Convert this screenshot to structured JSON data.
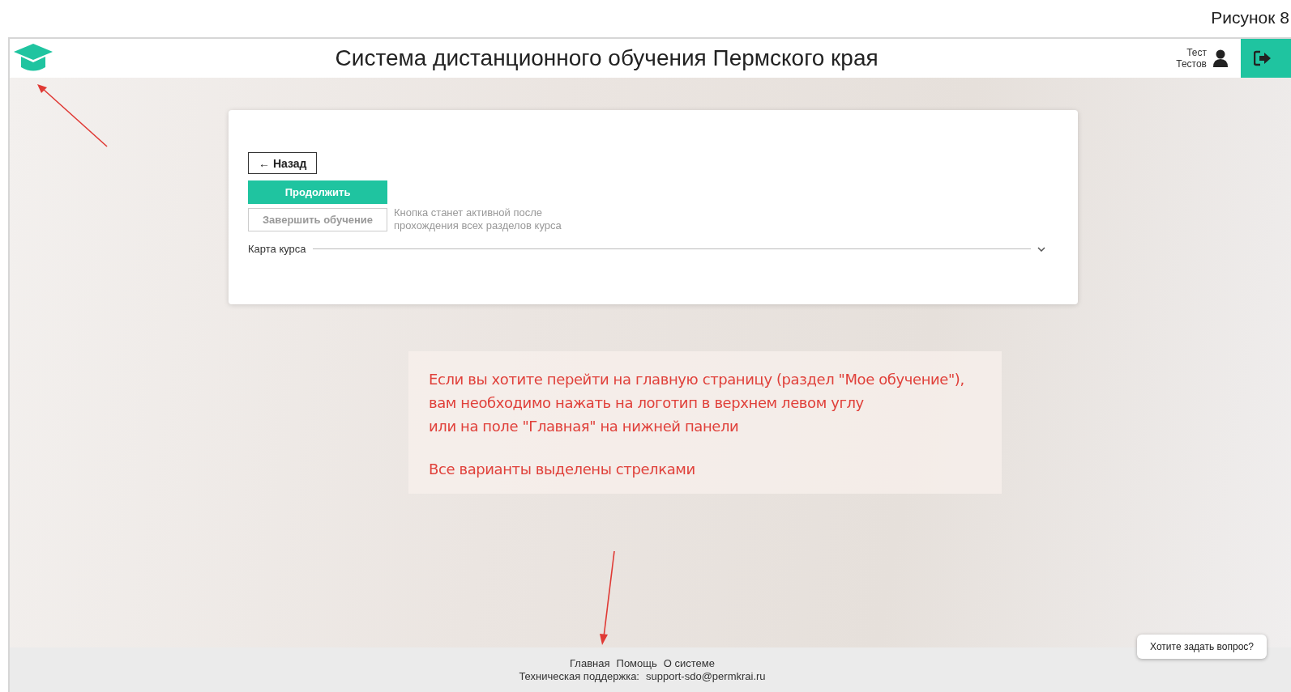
{
  "caption": "Рисунок 8",
  "header": {
    "title": "Система дистанционного обучения Пермского края",
    "user": [
      "Тест",
      "Тестов"
    ]
  },
  "card": {
    "back_button": "← Назад",
    "actions": [
      {
        "label": "Продолжить",
        "disabled": false
      },
      {
        "label": "Завершить обучение",
        "disabled": true
      }
    ],
    "hint": "Кнопка станет активной после прохождения всех разделов курса",
    "course_map": {
      "label": "Карта курса",
      "expanded": false
    }
  },
  "annotation": {
    "paragraphs": [
      [
        "Если вы хотите перейти на главную страницу (раздел \"Мое обучение\"),",
        "вам необходимо нажать на логотип в верхнем левом углу",
        "или на поле \"Главная\" на нижней панели"
      ],
      [
        "Все варианты выделены стрелками"
      ]
    ]
  },
  "chat_button": "Хотите задать вопрос?",
  "footer": {
    "links": [
      "Главная",
      "Помощь",
      "О системе"
    ],
    "support_label": "Техническая поддержка:",
    "support_email": "support-sdo@permkrai.ru"
  }
}
